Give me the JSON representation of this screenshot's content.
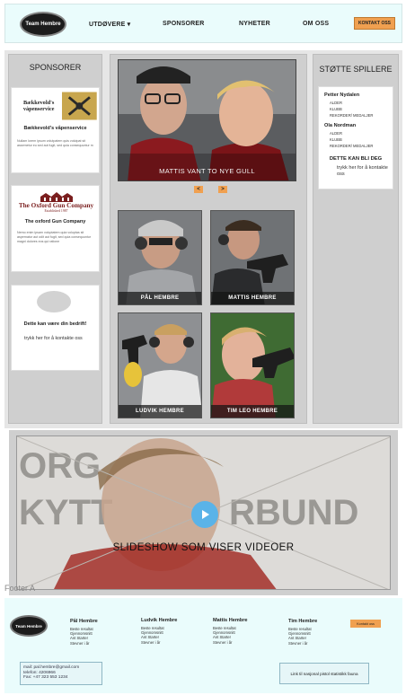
{
  "header": {
    "logo_text": "Team Hembre",
    "nav": [
      "UTDØVERE ▾",
      "SPONSORER",
      "NYHETER",
      "OM OSS"
    ],
    "contact_button": "KONTAKT OSS"
  },
  "sponsors": {
    "title": "SPONSORER",
    "cards": [
      {
        "logo_text": "Bækkevold's våpenservice",
        "name": "Bækkevold's våpenservice",
        "body": "Nullam lorem ipsum volutpatem quis volutpat sit assemetur eu sed aut fugit, sed quia consequuntur m"
      },
      {
        "logo_text": "The Oxford Gun Company",
        "logo_sub": "Established 1987",
        "name": "The oxford Gun Company",
        "body": "Nemo enim ipsam voluptatem quia voluptas sit aspernatur aut odit aut fugit, sed quia consequuntur magni dolores eos qui ratione"
      },
      {
        "name": "Dette kan være din bedrift!",
        "body": "trykk her for å kontakte oss"
      }
    ]
  },
  "hero": {
    "caption": "MATTIS VANT TO NYE GULL",
    "prev": "<",
    "next": ">"
  },
  "players": [
    {
      "name": "PÅL HEMBRE"
    },
    {
      "name": "MATTIS HEMBRE"
    },
    {
      "name": "LUDVIK HEMBRE"
    },
    {
      "name": "TIM LEO HEMBRE"
    }
  ],
  "support": {
    "title": "STØTTE SPILLERE",
    "entries": [
      {
        "name": "Petter Nydalen",
        "items": [
          "ALDER",
          "KLUBB",
          "REKORDER/ MEDALJER"
        ]
      },
      {
        "name": "Ola Nordman",
        "items": [
          "ALDER",
          "KLUBB",
          "REKORDER/ MEDALJER"
        ]
      }
    ],
    "become": "DETTE KAN BLI DEG",
    "link": "trykk her for å kontakte oss"
  },
  "video": {
    "caption": "SLIDESHOW SOM VISER VIDEOER",
    "bg_text_1": "ORG",
    "bg_text_2": "KYTT",
    "bg_text_3": "RBUND"
  },
  "footer_label": "Footer A",
  "footer": {
    "logo_text": "Team Hembre",
    "columns": [
      {
        "name": "Pål Hembre",
        "lines": [
          "Beste resultat",
          "Gjennomsnitt",
          "Ant Starter",
          "Stevner i år"
        ]
      },
      {
        "name": "Ludvik Hembre",
        "lines": [
          "Beste resultat",
          "Gjennomsnitt",
          "Ant Starter",
          "Stevner i år"
        ]
      },
      {
        "name": "Mattis Hembre",
        "lines": [
          "Beste resultat",
          "Gjennomsnitt",
          "Ant Starter",
          "Stevner i år"
        ]
      },
      {
        "name": "Tim Hembre",
        "lines": [
          "Beste resultat",
          "Gjennomsnitt",
          "Ant Starter",
          "Stevner i år"
        ]
      }
    ],
    "contact_button": "Kontakt oss",
    "info": [
      "mail: pal.hembre@gmail.com",
      "telefon: 4206966",
      "Fax: +47 323 553 1234"
    ],
    "link": "Link til nasjonal pistol statistikk fauna"
  },
  "colors": {
    "accent": "#f0a050",
    "header_bg": "#eafcfc",
    "panel": "#cfcfcf",
    "play": "#5ab3e8"
  }
}
